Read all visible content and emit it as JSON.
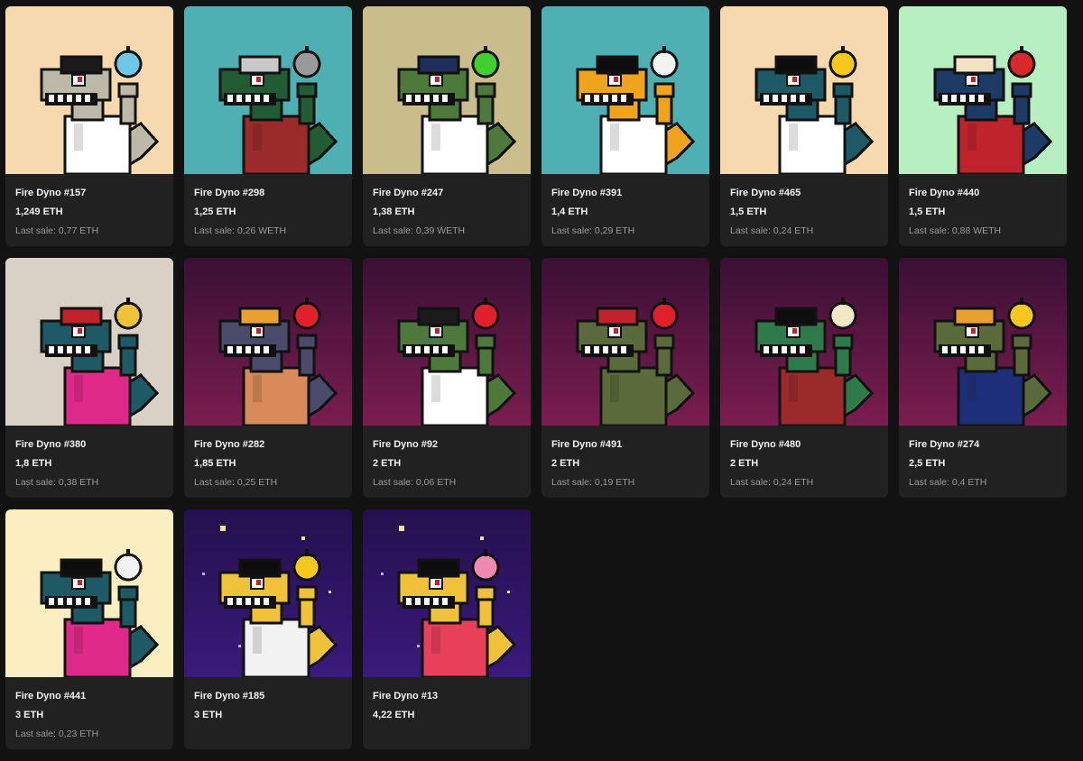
{
  "items": [
    {
      "name": "Fire Dyno #157",
      "price": "1,249 ETH",
      "last_sale": "Last sale: 0,77 ETH",
      "bg": "#f6d9ae",
      "bg2": "#f6d9ae",
      "skin": "#bdb9a8",
      "shirt": "#ffffff",
      "hat": "#1a1a1a",
      "item": "#6fc6e6",
      "item_icon": "egg-icon"
    },
    {
      "name": "Fire Dyno #298",
      "price": "1,25 ETH",
      "last_sale": "Last sale: 0,26 WETH",
      "bg": "#4fb0b3",
      "bg2": "#4fb0b3",
      "skin": "#225c34",
      "shirt": "#9b2a2a",
      "hat": "#c8c8c8",
      "item": "#9a9a9a",
      "item_icon": "golf-club-icon"
    },
    {
      "name": "Fire Dyno #247",
      "price": "1,38 ETH",
      "last_sale": "Last sale: 0,39 WETH",
      "bg": "#c9bd8c",
      "bg2": "#c9bd8c",
      "skin": "#4d7a3a",
      "shirt": "#ffffff",
      "hat": "#1f2f5a",
      "item": "#3fcf2f",
      "item_icon": "apple-icon"
    },
    {
      "name": "Fire Dyno #391",
      "price": "1,4 ETH",
      "last_sale": "Last sale: 0,29 ETH",
      "bg": "#4fb0b3",
      "bg2": "#4fb0b3",
      "skin": "#f0a41e",
      "shirt": "#ffffff",
      "hat": "#0e0e0e",
      "item": "#f2f2f2",
      "item_icon": "bone-icon"
    },
    {
      "name": "Fire Dyno #465",
      "price": "1,5 ETH",
      "last_sale": "Last sale: 0,24 ETH",
      "bg": "#f6d9ae",
      "bg2": "#f6d9ae",
      "skin": "#1e5a66",
      "shirt": "#ffffff",
      "hat": "#0e0e0e",
      "item": "#f6c81e",
      "item_icon": "chick-icon"
    },
    {
      "name": "Fire Dyno #440",
      "price": "1,5 ETH",
      "last_sale": "Last sale: 0,88 WETH",
      "bg": "#b8efc0",
      "bg2": "#b8efc0",
      "skin": "#1e3a66",
      "shirt": "#c0232b",
      "hat": "#f3e3c2",
      "item": "#d82a2a",
      "item_icon": "tennis-racket-icon"
    },
    {
      "name": "Fire Dyno #380",
      "price": "1,8 ETH",
      "last_sale": "Last sale: 0,38 ETH",
      "bg": "#d9d0c6",
      "bg2": "#d9d0c6",
      "skin": "#1e5a66",
      "shirt": "#e02a8a",
      "hat": "#c0232b",
      "item": "#f0c23a",
      "item_icon": "pencil-icon"
    },
    {
      "name": "Fire Dyno #282",
      "price": "1,85 ETH",
      "last_sale": "Last sale: 0,25 ETH",
      "bg": "#7a1d4f",
      "bg2": "#3a1034",
      "skin": "#4a4a6a",
      "shirt": "#d98a5a",
      "hat": "#e8a030",
      "item": "#e0202a",
      "item_icon": "balloon-icon"
    },
    {
      "name": "Fire Dyno #92",
      "price": "2 ETH",
      "last_sale": "Last sale: 0,06 ETH",
      "bg": "#7a1d4f",
      "bg2": "#3a1034",
      "skin": "#4d7a3a",
      "shirt": "#ffffff",
      "hat": "#1a1a1a",
      "item": "#e0202a",
      "item_icon": "rose-icon"
    },
    {
      "name": "Fire Dyno #491",
      "price": "2 ETH",
      "last_sale": "Last sale: 0,19 ETH",
      "bg": "#7a1d4f",
      "bg2": "#3a1034",
      "skin": "#5a6a3a",
      "shirt": "#5a6a3a",
      "hat": "#c0232b",
      "item": "#e0202a",
      "item_icon": "rose-icon"
    },
    {
      "name": "Fire Dyno #480",
      "price": "2 ETH",
      "last_sale": "Last sale: 0,24 ETH",
      "bg": "#7a1d4f",
      "bg2": "#3a1034",
      "skin": "#2e7a4a",
      "shirt": "#9b2a2a",
      "hat": "#0e0e0e",
      "item": "#f2e8c8",
      "item_icon": "candle-icon"
    },
    {
      "name": "Fire Dyno #274",
      "price": "2,5 ETH",
      "last_sale": "Last sale: 0,4 ETH",
      "bg": "#7a1d4f",
      "bg2": "#3a1034",
      "skin": "#5a6a3a",
      "shirt": "#1e2f7a",
      "hat": "#e8a030",
      "item": "#f6c81e",
      "item_icon": "chick-icon"
    },
    {
      "name": "Fire Dyno #441",
      "price": "3 ETH",
      "last_sale": "Last sale: 0,23 ETH",
      "bg": "#fbeec0",
      "bg2": "#fbeec0",
      "skin": "#1e5a66",
      "shirt": "#e02a8a",
      "hat": "#0e0e0e",
      "item": "#f2f2f2",
      "item_icon": "bone-icon"
    },
    {
      "name": "Fire Dyno #185",
      "price": "3 ETH",
      "last_sale": "",
      "bg": "#3a1a7a",
      "bg2": "#24104e",
      "skin": "#f0c23a",
      "shirt": "#f2f2f2",
      "hat": "#0e0e0e",
      "item": "#f6c81e",
      "item_icon": "star-icon"
    },
    {
      "name": "Fire Dyno #13",
      "price": "4,22 ETH",
      "last_sale": "",
      "bg": "#3a1a7a",
      "bg2": "#24104e",
      "skin": "#f0c23a",
      "shirt": "#e8405a",
      "hat": "#0e0e0e",
      "item": "#f08ab0",
      "item_icon": "donut-icon"
    }
  ]
}
